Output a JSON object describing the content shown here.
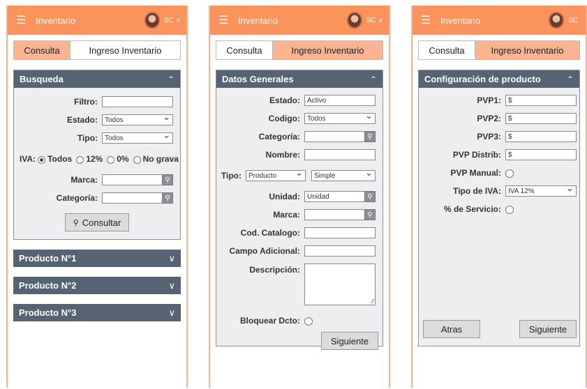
{
  "app": {
    "menu_icon": "hamburger-icon",
    "title": "Inventario",
    "user": "SC"
  },
  "tabs": {
    "consulta": "Consulta",
    "ingreso": "Ingreso Inventario"
  },
  "screen1": {
    "panel_title": "Busqueda",
    "filtro_label": "Filtro:",
    "estado_label": "Estado:",
    "estado_value": "Todos",
    "tipo_label": "Tipo:",
    "tipo_value": "Todos",
    "iva_label": "IVA:",
    "iva_options": [
      "Todos",
      "12%",
      "0%",
      "No grava"
    ],
    "iva_selected": "Todos",
    "marca_label": "Marca:",
    "categoria_label": "Categoría:",
    "consultar_button": "Consultar",
    "productos": [
      "Producto N°1",
      "Producto N°2",
      "Producto N°3"
    ]
  },
  "screen2": {
    "panel_title": "Datos Generales",
    "estado_label": "Estado:",
    "estado_value": "Activo",
    "codigo_label": "Codigo:",
    "codigo_value": "Todos",
    "categoria_label": "Categoría:",
    "nombre_label": "Nombre:",
    "tipo_label": "Tipo:",
    "tipo_value": "Producto",
    "tipo2_value": "Simple",
    "unidad_label": "Unidad:",
    "unidad_value": "Unidad",
    "marca_label": "Marca:",
    "cod_catalogo_label": "Cod. Catalogo:",
    "campo_adicional_label": "Campo Adicional:",
    "descripcion_label": "Descripción:",
    "bloquear_label": "Bloquear Dcto:",
    "siguiente_button": "Siguiente"
  },
  "screen3": {
    "panel_title": "Configuración de producto",
    "pvp1_label": "PVP1:",
    "pvp2_label": "PVP2:",
    "pvp3_label": "PVP3:",
    "pvp_distrib_label": "PVP Distrib:",
    "currency": "$",
    "pvp_manual_label": "PVP Manual:",
    "tipo_iva_label": "Tipo de IVA:",
    "tipo_iva_value": "IVA 12%",
    "servicio_label": "% de Servicio:",
    "atras_button": "Atras",
    "siguiente_button": "Siguiente"
  },
  "colors": {
    "accent": "#fa935c",
    "tab_active": "#fbb48f",
    "panel_header": "#566372",
    "panel_bg": "#eeeef0"
  }
}
